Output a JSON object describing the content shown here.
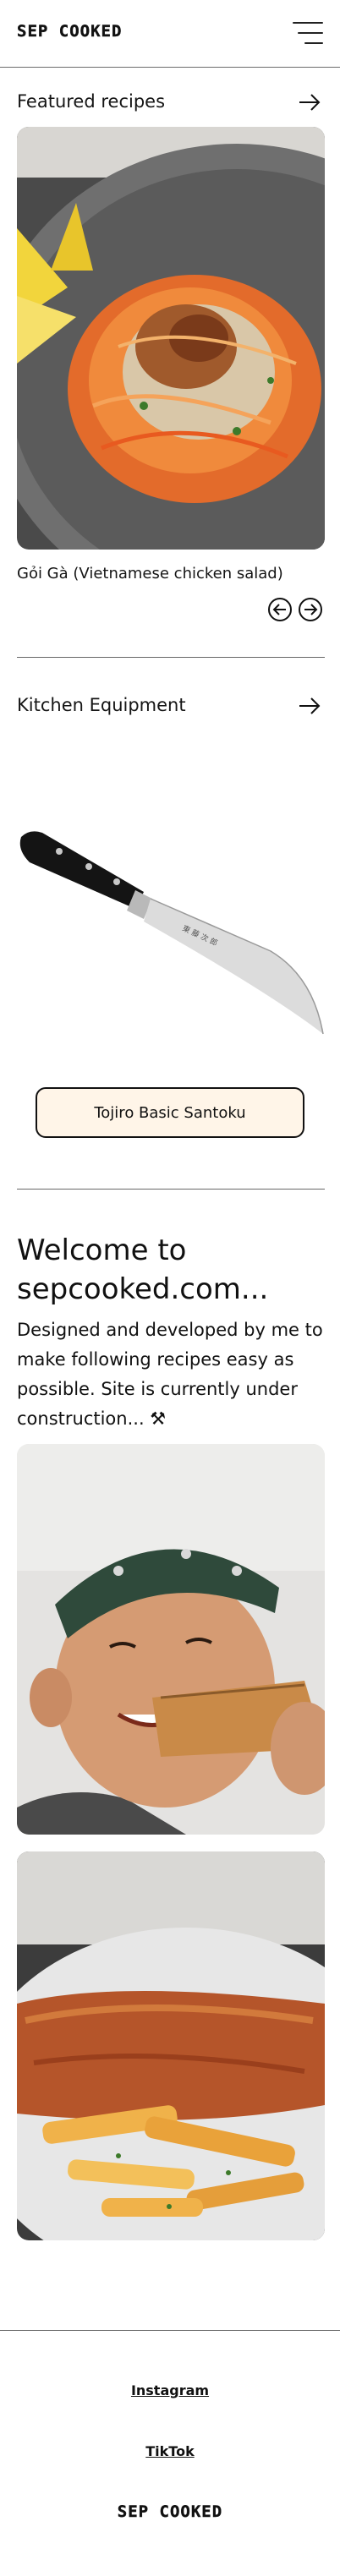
{
  "header": {
    "logo": "SEP COOKED",
    "menu_icon": "hamburger-menu-icon"
  },
  "featured": {
    "title": "Featured recipes",
    "arrow_icon": "arrow-right-icon",
    "recipe_name": "Gỏi Gà (Vietnamese chicken salad)",
    "prev_icon": "circle-arrow-left-icon",
    "next_icon": "circle-arrow-right-icon"
  },
  "equipment": {
    "title": "Kitchen Equipment",
    "arrow_icon": "arrow-right-icon",
    "item_label": "Tojiro Basic Santoku"
  },
  "welcome": {
    "title": "Welcome to sepcooked.com...",
    "body": "Designed and developed by me to make following recipes easy as possible. Site is currently under construction... ⚒"
  },
  "footer": {
    "links": [
      "Instagram",
      "TikTok"
    ],
    "logo": "SEP COOKED"
  },
  "colors": {
    "button_bg": "#fff5e8",
    "text": "#111111",
    "divider": "#666666"
  }
}
